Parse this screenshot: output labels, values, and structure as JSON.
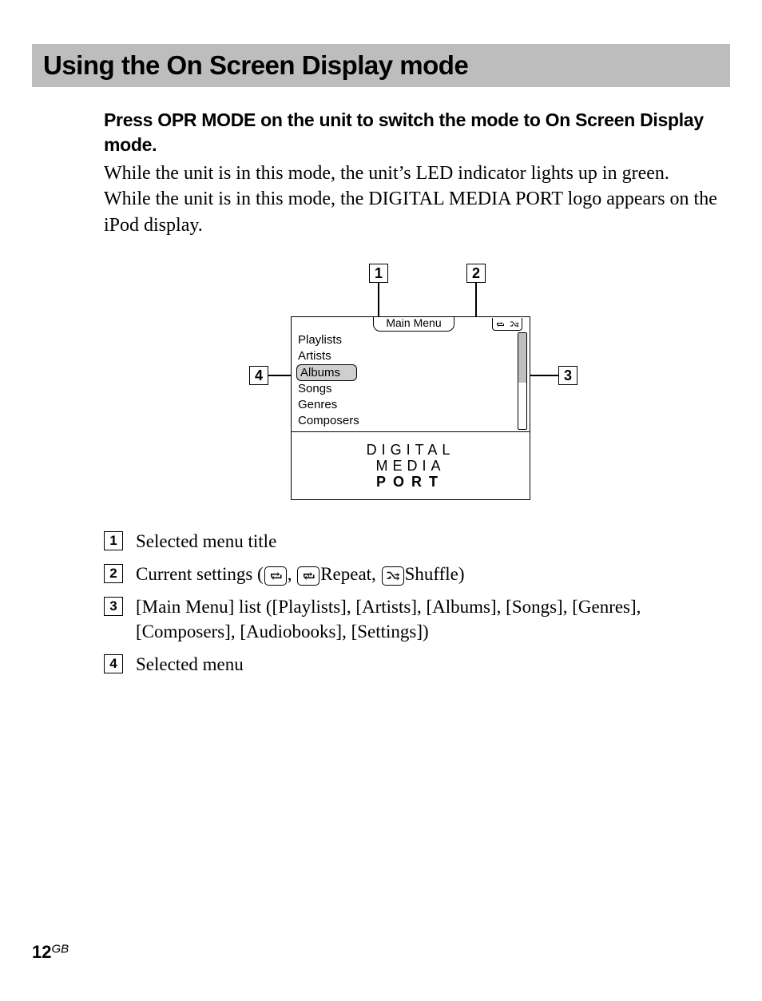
{
  "title": "Using the On Screen Display mode",
  "instruction_bold": "Press OPR MODE on the unit to switch the mode to On Screen Display mode.",
  "body_line1": "While the unit is in this mode, the unit’s LED indicator lights up in green.",
  "body_line2": "While the unit is in this mode, the DIGITAL MEDIA PORT logo appears on the iPod display.",
  "callouts": {
    "c1": "1",
    "c2": "2",
    "c3": "3",
    "c4": "4"
  },
  "screen": {
    "menu_title": "Main Menu",
    "items": {
      "i0": "Playlists",
      "i1": "Artists",
      "i2": "Albums",
      "i3": "Songs",
      "i4": "Genres",
      "i5": "Composers"
    },
    "logo": {
      "l1": "DIGITAL",
      "l2": "MEDIA",
      "l3": "PORT"
    }
  },
  "legend": {
    "n1": "1",
    "t1": "Selected menu title",
    "n2": "2",
    "t2a": "Current settings (",
    "t2b": ", ",
    "t2c": "Repeat, ",
    "t2d": "Shuffle)",
    "n3": "3",
    "t3": "[Main Menu] list ([Playlists], [Artists], [Albums], [Songs], [Genres], [Composers], [Audiobooks], [Settings])",
    "n4": "4",
    "t4": "Selected menu"
  },
  "footer": {
    "page": "12",
    "region": "GB"
  }
}
